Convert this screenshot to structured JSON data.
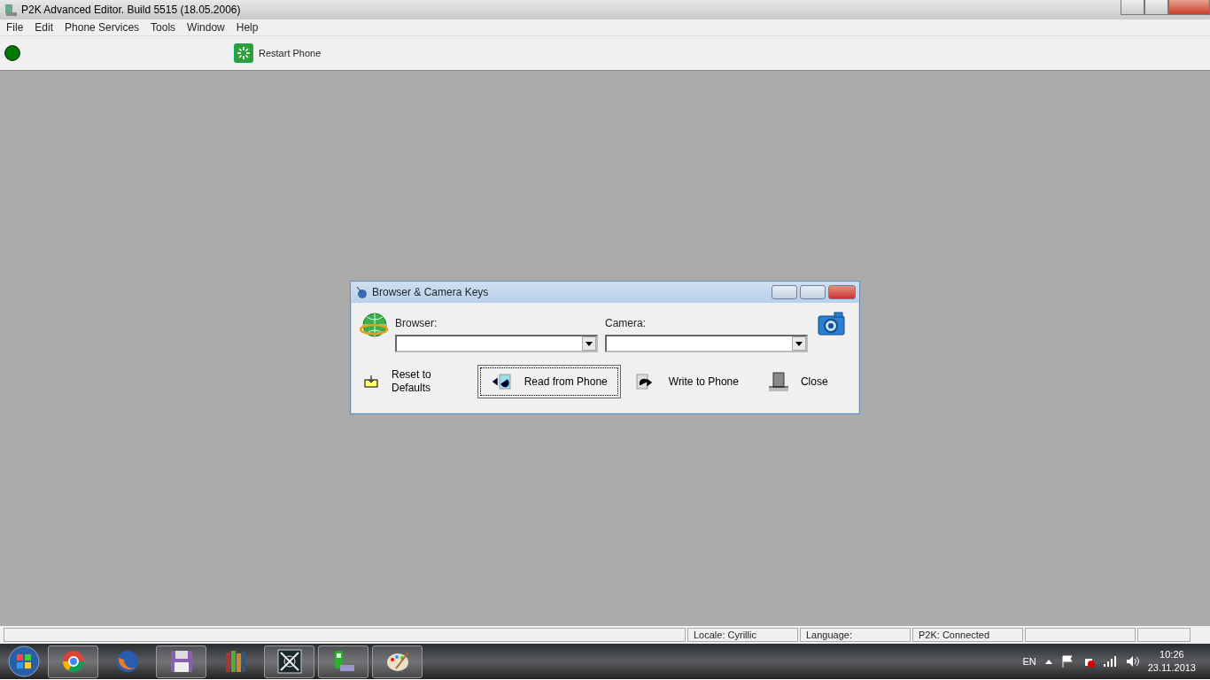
{
  "window": {
    "title": "P2K Advanced Editor. Build 5515 (18.05.2006)"
  },
  "menu": [
    "File",
    "Edit",
    "Phone Services",
    "Tools",
    "Window",
    "Help"
  ],
  "toolbar": {
    "connected": true,
    "buttons": [
      {
        "label": "Restart Phone"
      }
    ]
  },
  "dialog": {
    "title": "Browser & Camera Keys",
    "fields": [
      {
        "label": "Browser:"
      },
      {
        "label": "Camera:"
      }
    ],
    "buttons": [
      {
        "label": "Reset to",
        "label2": "Defaults",
        "kind": "reset",
        "selected": false
      },
      {
        "label": "Read from Phone",
        "kind": "read",
        "selected": true
      },
      {
        "label": "Write to Phone",
        "kind": "write",
        "selected": false
      },
      {
        "label": "Close",
        "kind": "close",
        "selected": false
      }
    ]
  },
  "status_bar": [
    "Locale: Cyrillic",
    "Language:",
    "P2K: Connected"
  ],
  "taskbar": {
    "apps": [
      {
        "kind": "chrome",
        "open": true
      },
      {
        "kind": "firefox",
        "open": false
      },
      {
        "kind": "disk",
        "open": true
      },
      {
        "kind": "books",
        "open": false
      },
      {
        "kind": "xapp",
        "open": true
      },
      {
        "kind": "phone",
        "open": true
      },
      {
        "kind": "paint",
        "open": true
      }
    ],
    "language": "EN",
    "time": "10:26",
    "date": "23.11.2013"
  }
}
